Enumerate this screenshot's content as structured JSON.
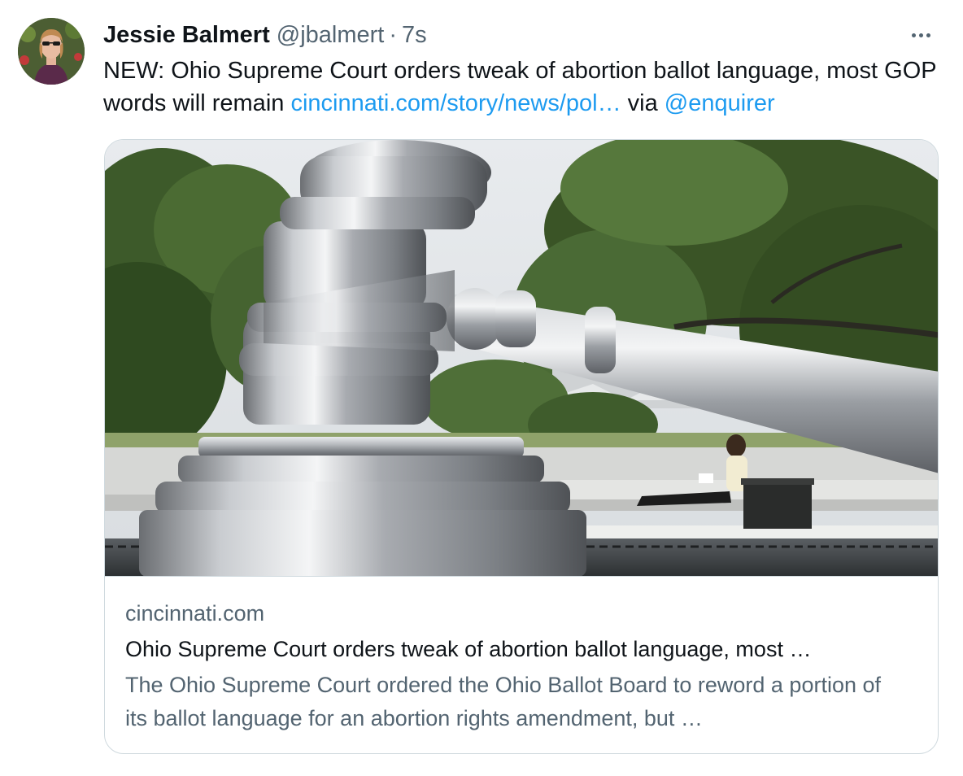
{
  "tweet": {
    "author": {
      "display_name": "Jessie Balmert",
      "handle": "@jbalmert",
      "separator": "·",
      "time": "7s",
      "avatar_icon": "user-avatar-photo"
    },
    "more_icon": "more-horizontal-icon",
    "text_segments": [
      {
        "type": "text",
        "value": "NEW: Ohio Supreme Court orders tweak of abortion ballot language, most GOP words will remain "
      },
      {
        "type": "link",
        "value": "cincinnati.com/story/news/pol…"
      },
      {
        "type": "text",
        "value": " via "
      },
      {
        "type": "mention",
        "value": "@enquirer"
      }
    ],
    "card": {
      "image_description_icon": "gavel-sculpture-photo",
      "domain": "cincinnati.com",
      "title": "Ohio Supreme Court orders tweak of abortion ballot language, most …",
      "description": "The Ohio Supreme Court ordered the Ohio Ballot Board to reword a portion of its ballot language for an abortion rights amendment, but …"
    }
  },
  "colors": {
    "link": "#1d9bf0",
    "secondary_text": "#536471",
    "primary_text": "#0f1419",
    "border": "#cfd9de"
  }
}
